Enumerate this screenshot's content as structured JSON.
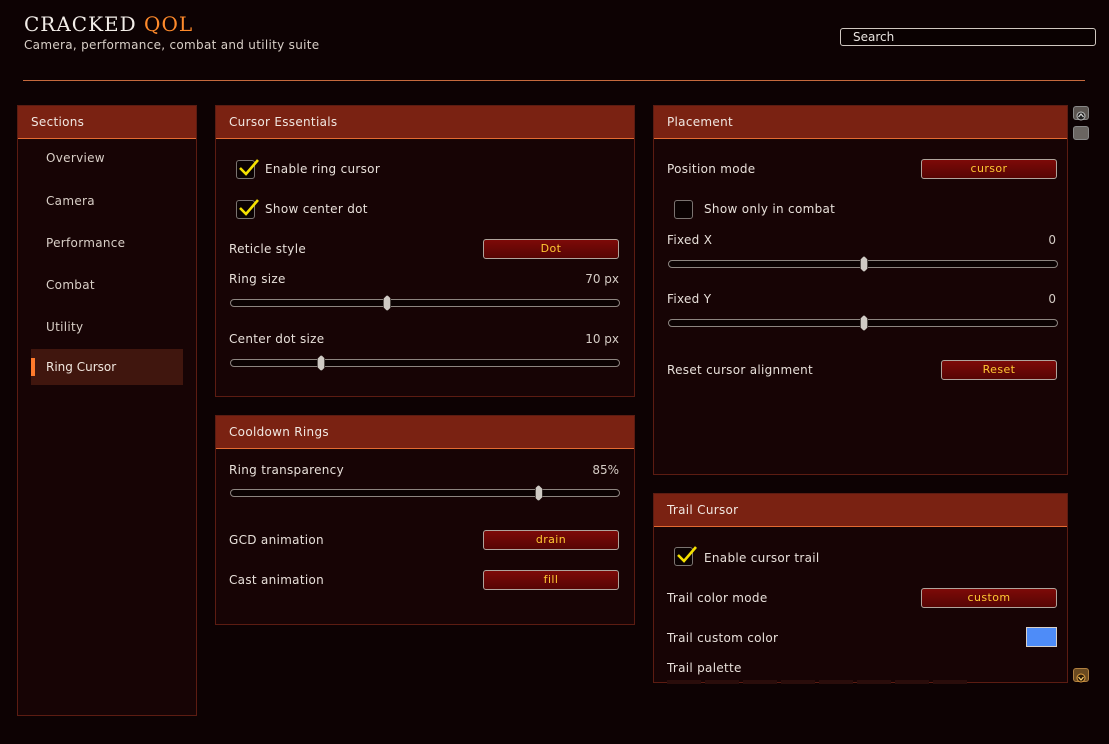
{
  "header": {
    "title_main": "CRACKED",
    "title_accent": "QOL",
    "subtitle": "Camera, performance, combat and utility suite",
    "search_placeholder": "Search"
  },
  "sidebar": {
    "title": "Sections",
    "items": [
      {
        "label": "Overview"
      },
      {
        "label": "Camera"
      },
      {
        "label": "Performance"
      },
      {
        "label": "Combat"
      },
      {
        "label": "Utility"
      },
      {
        "label": "Ring Cursor"
      }
    ],
    "active": "Ring Cursor"
  },
  "cursor_essentials": {
    "title": "Cursor Essentials",
    "enable_ring_cursor": {
      "label": "Enable ring cursor",
      "checked": true
    },
    "show_center_dot": {
      "label": "Show center dot",
      "checked": true
    },
    "reticle_style": {
      "label": "Reticle style",
      "value": "Dot"
    },
    "ring_size": {
      "label": "Ring size",
      "value": "70 px",
      "fraction": 0.4
    },
    "center_dot_size": {
      "label": "Center dot size",
      "value": "10 px",
      "fraction": 0.23
    }
  },
  "cooldown_rings": {
    "title": "Cooldown Rings",
    "ring_transparency": {
      "label": "Ring transparency",
      "value": "85%",
      "fraction": 0.79
    },
    "gcd_animation": {
      "label": "GCD animation",
      "value": "drain"
    },
    "cast_animation": {
      "label": "Cast animation",
      "value": "fill"
    }
  },
  "placement": {
    "title": "Placement",
    "position_mode": {
      "label": "Position mode",
      "value": "cursor"
    },
    "show_only_in_combat": {
      "label": "Show only in combat",
      "checked": false
    },
    "fixed_x": {
      "label": "Fixed X",
      "value": "0",
      "fraction": 0.5
    },
    "fixed_y": {
      "label": "Fixed Y",
      "value": "0",
      "fraction": 0.5
    },
    "reset_alignment": {
      "label": "Reset cursor alignment",
      "button": "Reset"
    }
  },
  "trail_cursor": {
    "title": "Trail Cursor",
    "enable_cursor_trail": {
      "label": "Enable cursor trail",
      "checked": true
    },
    "trail_color_mode": {
      "label": "Trail color mode",
      "value": "custom"
    },
    "trail_custom_color": {
      "label": "Trail custom color",
      "color": "#4e8cf8"
    },
    "trail_palette": {
      "label": "Trail palette"
    }
  },
  "colors": {
    "accent": "#ff8a2b",
    "header_bar": "#7a2212",
    "dropdown": "#7d0a08",
    "dropdown_text": "#ffc933",
    "check": "#f5e000"
  }
}
